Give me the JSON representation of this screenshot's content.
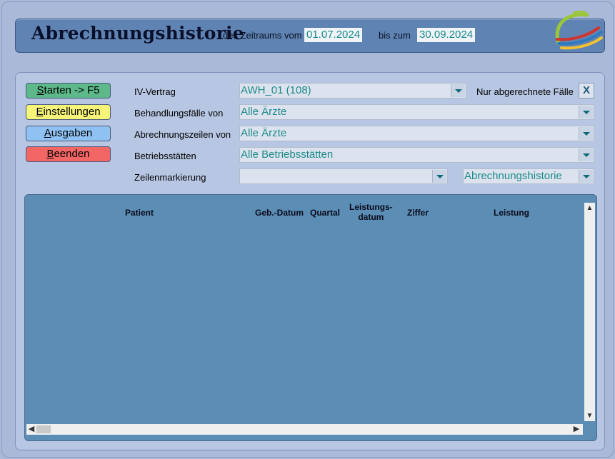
{
  "header": {
    "title": "Abrechnungshistorie",
    "from_label": "des Zeitraums vom",
    "from_date": "01.07.2024",
    "to_label": "bis zum",
    "to_date": "30.09.2024"
  },
  "buttons": {
    "start": {
      "underline": "S",
      "rest": "tarten -> F5",
      "color": "#5db88a"
    },
    "settings": {
      "underline": "E",
      "rest": "instellungen",
      "color": "#f7f579"
    },
    "outputs": {
      "underline": "A",
      "rest": "usgaben",
      "color": "#8fc2f2"
    },
    "exit": {
      "underline": "B",
      "rest": "eenden",
      "color": "#f26666"
    }
  },
  "filters": {
    "iv_vertrag": {
      "label": "IV-Vertrag",
      "value": "AWH_01 (108)"
    },
    "behandlungsfaelle": {
      "label": "Behandlungsfälle von",
      "value": "Alle Ärzte"
    },
    "abrechnungszeilen": {
      "label": "Abrechnungszeilen von",
      "value": "Alle Ärzte"
    },
    "betriebsstaetten": {
      "label": "Betriebsstätten",
      "value": "Alle Betriebsstätten"
    },
    "zeilenmarkierung": {
      "label": "Zeilenmarkierung",
      "value": ""
    },
    "view_select": {
      "value": "Abrechnungshistorie"
    },
    "only_billed": {
      "label": "Nur abgerechnete Fälle",
      "mark": "X"
    }
  },
  "table": {
    "columns": [
      "Patient",
      "Geb.-Datum",
      "Quartal",
      "Leistungs-\ndatum",
      "Ziffer",
      "Leistung"
    ],
    "rows": []
  },
  "icons": {
    "dropdown": "chevron-down-icon",
    "scroll_up": "scroll-up-icon",
    "scroll_down": "scroll-down-icon",
    "scroll_left": "scroll-left-icon",
    "scroll_right": "scroll-right-icon"
  }
}
